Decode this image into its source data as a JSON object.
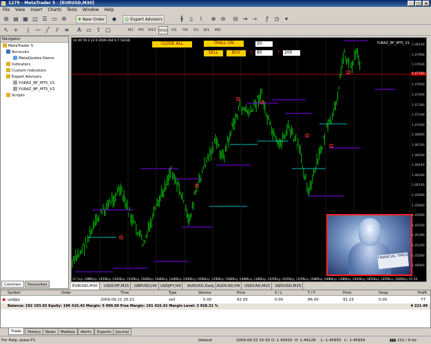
{
  "window": {
    "title": "1279 - MetaTrader 5 - [EURUSD,M30]"
  },
  "menu": [
    "File",
    "View",
    "Insert",
    "Charts",
    "Tools",
    "Window",
    "Help"
  ],
  "toolbar": {
    "new_order": "New Order",
    "expert_advisors": "Expert Advisors",
    "timeframes": [
      "M1",
      "M5",
      "M15",
      "M30",
      "H1",
      "H4",
      "D1",
      "W1",
      "MN"
    ],
    "active_timeframe": "M30"
  },
  "navigator": {
    "root": "MetaTrader 5",
    "items": [
      "Accounts",
      "MetaQuotes-Demo",
      "Indicators",
      "Custom Indicators",
      "Expert Advisors",
      "YURAZ_BF_MT5_V1",
      "YURAZ_BF_MT5_V2",
      "Scripts"
    ],
    "tabs": [
      "Common",
      "Favourites"
    ]
  },
  "chart": {
    "caption": "14 40 59.2 22.9 2009.264 0.7 50236",
    "ea_label": "YURAZ_BF_MT5_V1",
    "buttons": {
      "close_all": "CLOSE ALL",
      "trall_on": "TRALL ON",
      "sell": "SELL",
      "buy": "BUY",
      "trall_value": "50",
      "sl_label": "S",
      "sl_value": "80",
      "tp_label": "T",
      "tp_value": "200"
    },
    "price_labels": [
      "1.48140",
      "1.47990",
      "1.47930",
      "1.47790",
      "1.47640",
      "1.47490",
      "1.47340",
      "1.47190",
      "1.47040",
      "1.46890",
      "1.46740",
      "1.46590",
      "1.46440",
      "1.46290",
      "1.46140",
      "1.45990",
      "1.45840",
      "1.45690",
      "1.45540",
      "1.45390",
      "1.45240",
      "1.45090",
      "1.44940"
    ],
    "current_price": "1.47783",
    "time_labels": [
      "10 Sep 2009",
      "10 Sep 19:00",
      "11 Sep 03:00",
      "11 Sep 11:00",
      "11 Sep 19:00",
      "14 Sep 04:00",
      "14 Sep 12:00",
      "14 Sep 20:00",
      "15 Sep 04:00",
      "15 Sep 12:00",
      "15 Sep 20:00",
      "16 Sep 04:00",
      "16 Sep 12:00",
      "16 Sep 20:00",
      "17 Sep 04:00",
      "17 Sep 12:00",
      "17 Sep 20:00",
      "18 Sep 04:00",
      "18 Sep 12:00",
      "18 Sep 20:00",
      "21 Sep 04:00",
      "21 Sep 12:00",
      "21 Sep 20:00",
      "22 Sep 05:00"
    ],
    "photo_text": "FINANCIAL TIMES"
  },
  "symbol_tabs": [
    "EURUSD,M30",
    "USDCHF,M15",
    "GBPUSD,H4",
    "USDJPY,H4",
    "AUDUSD,Daily",
    "AUDCAD,H4",
    "USDCAD,M15",
    "NZDUSD,M15"
  ],
  "active_symbol_tab": "EURUSD,M30",
  "terminal": {
    "columns": [
      "Symbol",
      "Order",
      "Time",
      "Type",
      "Volume",
      "Price",
      "S / L",
      "T / P",
      "Price",
      "Swap",
      "Profit"
    ],
    "row": {
      "symbol": "usdjpy",
      "order": "",
      "time": "2009.09.21 20:21",
      "type": "sell",
      "volume": "5.00",
      "price": "92.00",
      "sl": "0.00",
      "tp": "86.00",
      "cur_price": "91.23",
      "swap": "0.00",
      "profit": "77"
    },
    "balance_line": "Balance: 192 193.93  Equity: 196 415.42  Margin: 5 000.00  Free Margin: 191 415.42  Margin Level: 3 928.31 %",
    "balance_profit": "4 221.49",
    "tabs": [
      "Trade",
      "History",
      "News",
      "Mailbox",
      "Alerts",
      "Experts",
      "Journal"
    ],
    "active_tab": "Trade"
  },
  "status": {
    "help": "For Help, press F1",
    "profile": "Default",
    "time": "2009.09.15 15:30",
    "open": "O: 1.45910",
    "high": "H: 1.46128",
    "low": "L: 1.45850",
    "close": "C: 1.45939",
    "traffic": "101 / 6 kb"
  },
  "colors": {
    "chart_bg": "#000000",
    "candle": "#00c000",
    "accent_yellow": "#f8d000",
    "level_violet": "#8000ff",
    "level_red": "#c00000",
    "level_cyan": "#00c0c0"
  }
}
